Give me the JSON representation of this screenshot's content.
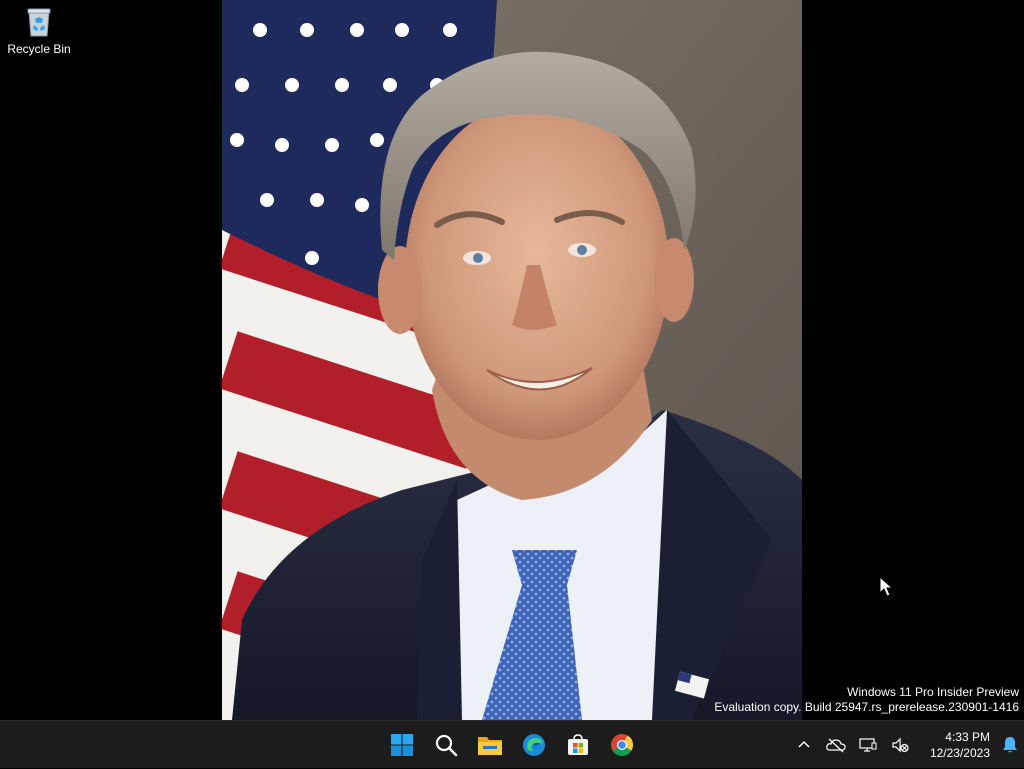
{
  "desktop": {
    "icons": [
      {
        "label": "Recycle Bin",
        "icon": "recycle-bin-icon"
      }
    ],
    "wallpaper": {
      "description_icon": "portrait-photo"
    },
    "watermark": {
      "line1": "Windows 11 Pro Insider Preview",
      "line2": "Evaluation copy. Build 25947.rs_prerelease.230901-1416"
    }
  },
  "taskbar": {
    "apps": [
      {
        "name": "Start",
        "icon": "windows-start-icon"
      },
      {
        "name": "Search",
        "icon": "search-icon"
      },
      {
        "name": "File Explorer",
        "icon": "file-explorer-icon"
      },
      {
        "name": "Microsoft Edge",
        "icon": "edge-icon"
      },
      {
        "name": "Microsoft Store",
        "icon": "store-icon"
      },
      {
        "name": "Google Chrome",
        "icon": "chrome-icon"
      }
    ],
    "tray": {
      "icons": [
        "chevron-up-icon",
        "onedrive-offline-icon",
        "network-icon",
        "volume-muted-icon",
        "notification-bell-icon"
      ],
      "time": "4:33 PM",
      "date": "12/23/2023"
    }
  },
  "colors": {
    "taskbar_bg": "#1c1c1c",
    "accent": "#0078d4"
  }
}
